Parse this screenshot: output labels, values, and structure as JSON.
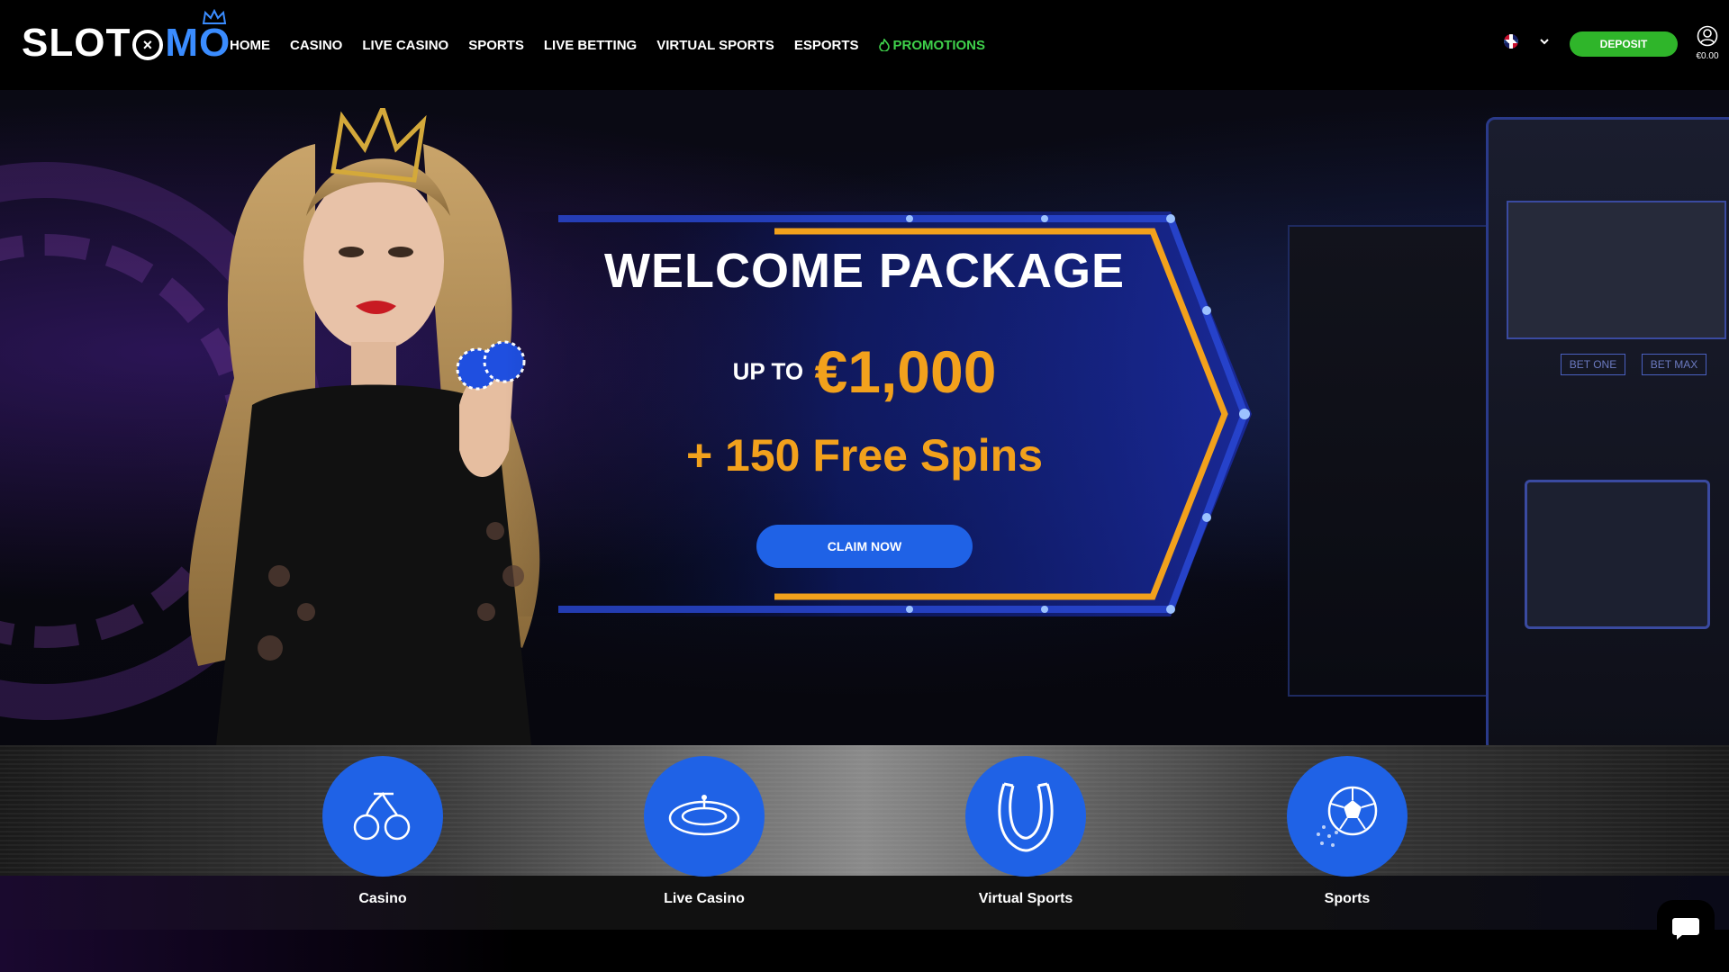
{
  "header": {
    "logo": {
      "part1": "SLOT",
      "ring": "×",
      "part2": "MO"
    },
    "nav": [
      {
        "label": "HOME"
      },
      {
        "label": "CASINO"
      },
      {
        "label": "LIVE CASINO"
      },
      {
        "label": "SPORTS"
      },
      {
        "label": "LIVE BETTING"
      },
      {
        "label": "VIRTUAL SPORTS"
      },
      {
        "label": "ESPORTS"
      },
      {
        "label": "PROMOTIONS"
      }
    ],
    "deposit_label": "DEPOSIT",
    "balance": "€0.00"
  },
  "hero": {
    "title": "WELCOME PACKAGE",
    "up_to": "UP TO",
    "amount": "€1,000",
    "spins": "+ 150 Free Spins",
    "cta": "CLAIM NOW",
    "slot_btn1": "BET ONE",
    "slot_btn2": "BET MAX"
  },
  "categories": [
    {
      "label": "Casino",
      "icon": "cherries-icon"
    },
    {
      "label": "Live Casino",
      "icon": "roulette-icon"
    },
    {
      "label": "Virtual Sports",
      "icon": "horseshoe-icon"
    },
    {
      "label": "Sports",
      "icon": "soccer-ball-icon"
    }
  ],
  "colors": {
    "accent_blue": "#1f62e6",
    "deposit_green": "#2fb52a",
    "promo_green": "#3fd14b",
    "gold": "#f2a11c"
  }
}
